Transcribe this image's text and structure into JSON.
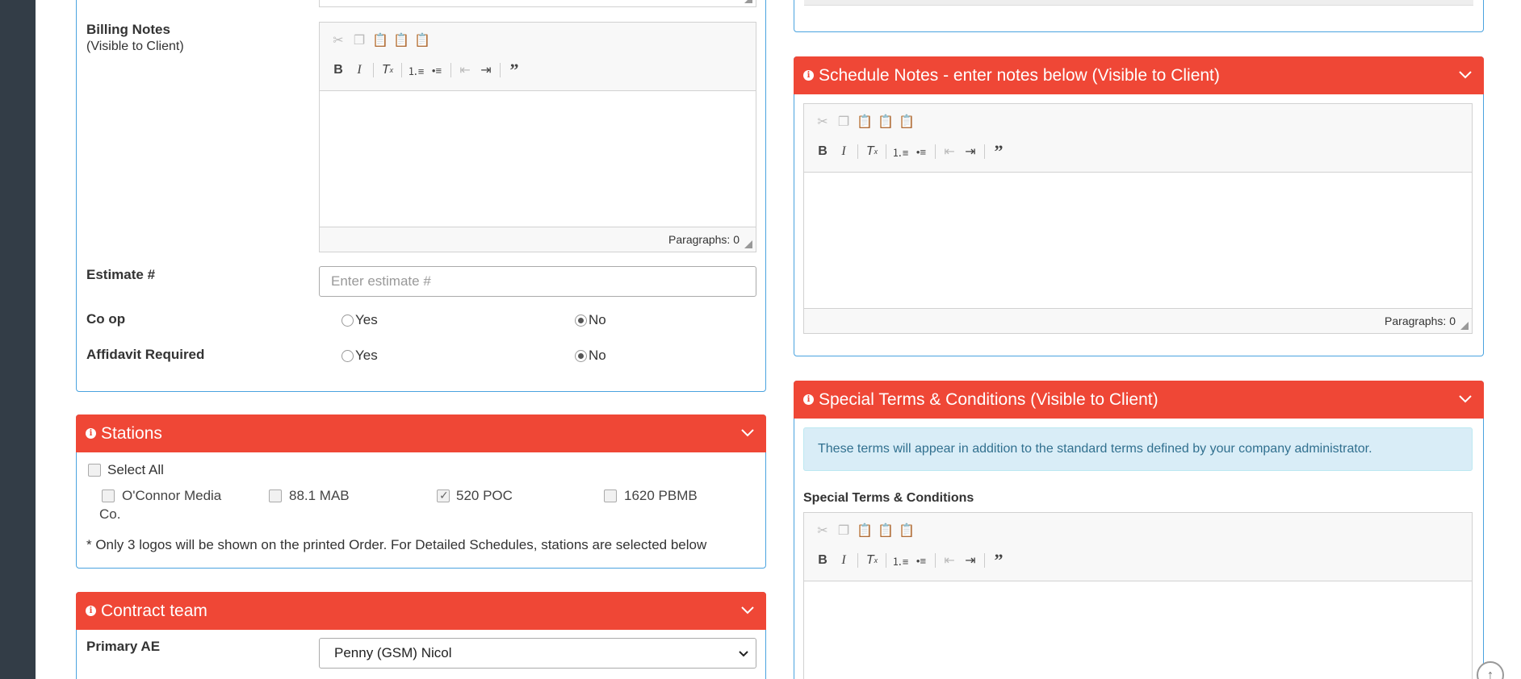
{
  "billing": {
    "label": "Billing Notes",
    "sublabel": "(Visible to Client)",
    "footer": "Paragraphs: 0"
  },
  "estimate": {
    "label": "Estimate #",
    "placeholder": "Enter estimate #"
  },
  "coop": {
    "label": "Co op",
    "yes": "Yes",
    "no": "No",
    "selected": "No"
  },
  "affidavit": {
    "label": "Affidavit Required",
    "yes": "Yes",
    "no": "No",
    "selected": "No"
  },
  "stations": {
    "title": "Stations",
    "select_all": "Select All",
    "items": [
      {
        "label": "O'Connor Media",
        "label2": "Co.",
        "checked": false
      },
      {
        "label": "88.1 MAB",
        "checked": false
      },
      {
        "label": "520 POC",
        "checked": true
      },
      {
        "label": "1620 PBMB",
        "checked": false
      }
    ],
    "note": "* Only 3 logos will be shown on the printed Order. For Detailed Schedules, stations are selected below"
  },
  "contract": {
    "title": "Contract team",
    "primary_ae_label": "Primary AE",
    "primary_ae_value": "Penny (GSM) Nicol"
  },
  "schedule": {
    "title": "Schedule Notes - enter notes below (Visible to Client)",
    "footer": "Paragraphs: 0"
  },
  "terms": {
    "title": "Special Terms & Conditions (Visible to Client)",
    "alert": "These terms will appear in addition to the standard terms defined by your company administrator.",
    "label": "Special Terms & Conditions"
  },
  "icons": [
    "cut-icon",
    "copy-icon",
    "paste-icon",
    "paste-text-icon",
    "paste-word-icon",
    "bold-icon",
    "italic-icon",
    "remove-format-icon",
    "numbered-list-icon",
    "bulleted-list-icon",
    "outdent-icon",
    "indent-icon",
    "blockquote-icon",
    "info-icon",
    "chevron-down-icon",
    "scroll-top-icon"
  ],
  "colors": {
    "panel_header": "#ef4736",
    "panel_border": "#4aa3df",
    "sidebar": "#333d47",
    "alert_bg": "#d9edf7"
  }
}
